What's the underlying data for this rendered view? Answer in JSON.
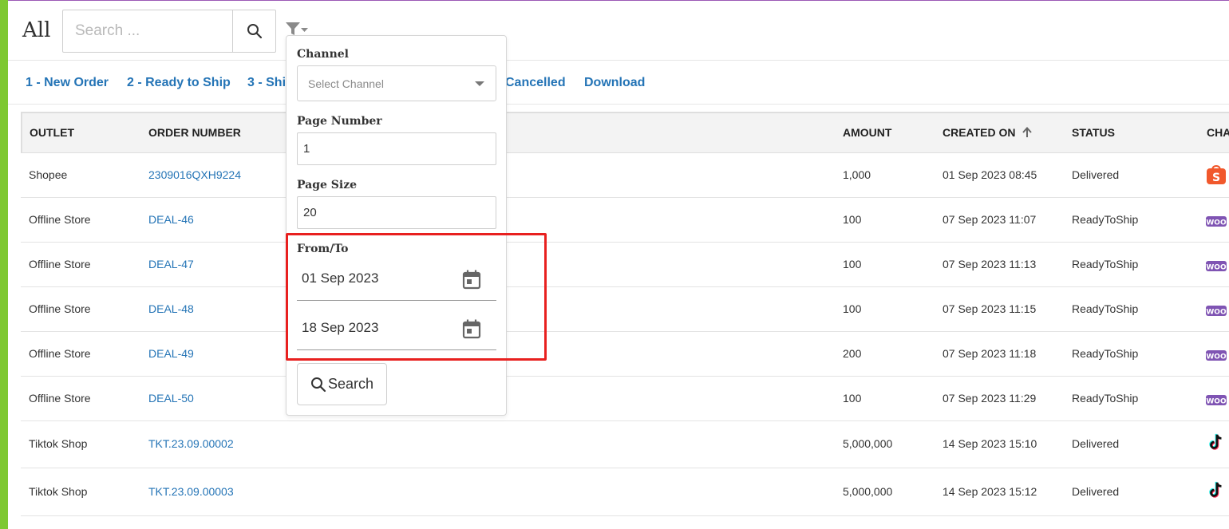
{
  "header": {
    "title": "All",
    "search_placeholder": "Search ...",
    "search_value": ""
  },
  "tabs": [
    {
      "label": "1 - New Order"
    },
    {
      "label": "2 - Ready to Ship"
    },
    {
      "label": "3 - Shi"
    },
    {
      "label": "Cancelled"
    },
    {
      "label": "Download"
    }
  ],
  "table": {
    "columns": [
      "OUTLET",
      "ORDER NUMBER",
      "AMOUNT",
      "CREATED ON",
      "STATUS",
      "CHA"
    ],
    "sort_indicator": "arrow-up",
    "rows": [
      {
        "outlet": "Shopee",
        "order": "2309016QXH9224",
        "amount": "1,000",
        "created": "01 Sep 2023 08:45",
        "status": "Delivered",
        "channel_icon": "shopee-icon"
      },
      {
        "outlet": "Offline Store",
        "order": "DEAL-46",
        "amount": "100",
        "created": "07 Sep 2023 11:07",
        "status": "ReadyToShip",
        "channel_icon": "woocommerce-icon"
      },
      {
        "outlet": "Offline Store",
        "order": "DEAL-47",
        "amount": "100",
        "created": "07 Sep 2023 11:13",
        "status": "ReadyToShip",
        "channel_icon": "woocommerce-icon"
      },
      {
        "outlet": "Offline Store",
        "order": "DEAL-48",
        "amount": "100",
        "created": "07 Sep 2023 11:15",
        "status": "ReadyToShip",
        "channel_icon": "woocommerce-icon"
      },
      {
        "outlet": "Offline Store",
        "order": "DEAL-49",
        "amount": "200",
        "created": "07 Sep 2023 11:18",
        "status": "ReadyToShip",
        "channel_icon": "woocommerce-icon"
      },
      {
        "outlet": "Offline Store",
        "order": "DEAL-50",
        "amount": "100",
        "created": "07 Sep 2023 11:29",
        "status": "ReadyToShip",
        "channel_icon": "woocommerce-icon"
      },
      {
        "outlet": "Tiktok Shop",
        "order": "TKT.23.09.00002",
        "amount": "5,000,000",
        "created": "14 Sep 2023 15:10",
        "status": "Delivered",
        "channel_icon": "tiktok-icon"
      },
      {
        "outlet": "Tiktok Shop",
        "order": "TKT.23.09.00003",
        "amount": "5,000,000",
        "created": "14 Sep 2023 15:12",
        "status": "Delivered",
        "channel_icon": "tiktok-icon"
      }
    ]
  },
  "filter": {
    "channel_label": "Channel",
    "channel_placeholder": "Select Channel",
    "page_number_label": "Page Number",
    "page_number_value": "1",
    "page_size_label": "Page Size",
    "page_size_value": "20",
    "from_to_label": "From/To",
    "from_date": "01 Sep 2023",
    "to_date": "18 Sep 2023",
    "search_button_label": "Search"
  },
  "colors": {
    "accent_link": "#2474b6",
    "left_bar": "#7ec832",
    "highlight": "#e8201f",
    "shopee": "#f1582c",
    "woocommerce": "#7f54b3"
  }
}
